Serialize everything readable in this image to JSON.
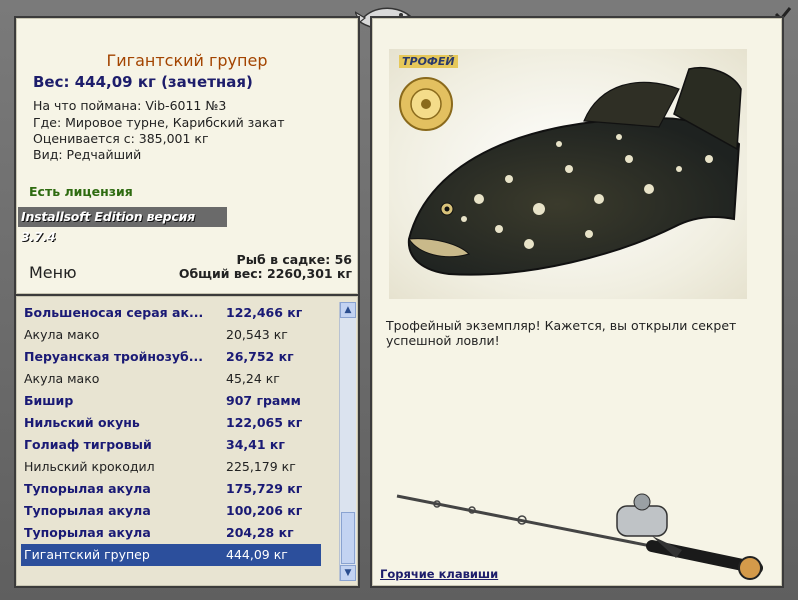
{
  "fish": {
    "name": "Гигантский групер",
    "weight_line": "Вес: 444,09 кг (зачетная)",
    "caught_on": "На что поймана: Vib-6011 №3",
    "where": "Где: Мировое турне, Карибский закат",
    "valued_from": "Оценивается с: 385,001 кг",
    "kind": "Вид: Редчайший"
  },
  "license": "Есть лицензия",
  "edition": "Installsoft Edition версия 3.7.4",
  "stats": {
    "fish_in_net": "Рыб в садке: 56",
    "total_weight": "Общий вес: 2260,301 кг"
  },
  "menu_label": "Меню",
  "catch_list": [
    {
      "name": "Большеносая серая ак...",
      "weight": "122,466 кг"
    },
    {
      "name": "Акула мако",
      "weight": "20,543 кг"
    },
    {
      "name": "Перуанская тройнозуб...",
      "weight": "26,752 кг"
    },
    {
      "name": "Акула мако",
      "weight": "45,24 кг"
    },
    {
      "name": "Бишир",
      "weight": "907 грамм"
    },
    {
      "name": "Нильский окунь",
      "weight": "122,065 кг"
    },
    {
      "name": "Голиаф тигровый",
      "weight": "34,41 кг"
    },
    {
      "name": "Нильский крокодил",
      "weight": "225,179 кг"
    },
    {
      "name": "Тупорылая акула",
      "weight": "175,729 кг"
    },
    {
      "name": "Тупорылая акула",
      "weight": "100,206 кг"
    },
    {
      "name": "Тупорылая акула",
      "weight": "204,28 кг"
    },
    {
      "name": "Гигантский групер",
      "weight": "444,09 кг"
    }
  ],
  "trophy_badge": "ТРОФЕЙ",
  "description": "Трофейный экземпляр! Кажется, вы открыли секрет успешной ловли!",
  "hotkeys_link": "Горячие клавиши",
  "icons": [
    "fish-logo-icon",
    "checkmark-icon",
    "scroll-up-icon",
    "scroll-down-icon",
    "trophy-reel-icon",
    "fishing-rod-icon"
  ],
  "colors": {
    "title": "#a34400",
    "weight": "#1d1d6b",
    "license": "#2e6b10",
    "selection": "#2c4f9c"
  }
}
